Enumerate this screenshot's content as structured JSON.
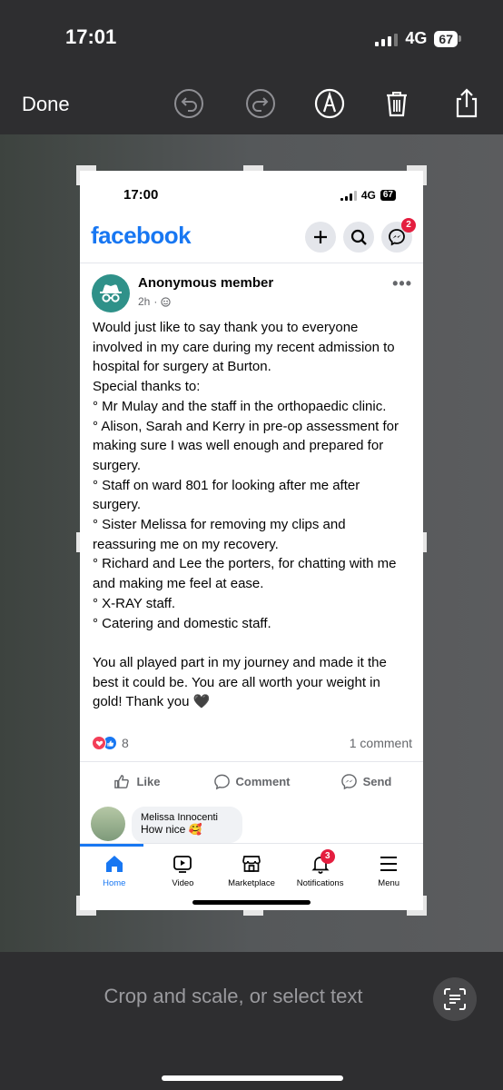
{
  "outer_status": {
    "time": "17:01",
    "network": "4G",
    "battery": "67"
  },
  "toolbar": {
    "done_label": "Done",
    "icons": [
      "undo-icon",
      "redo-icon",
      "markup-icon",
      "trash-icon",
      "share-icon"
    ]
  },
  "inner_status": {
    "time": "17:00",
    "network": "4G",
    "battery": "67"
  },
  "facebook": {
    "logo": "facebook",
    "messenger_badge": "2",
    "post": {
      "author": "Anonymous member",
      "time": "2h",
      "body": "Would just like to say thank you to everyone involved in my care during my recent admission to hospital for surgery at Burton.\nSpecial thanks to:\n °  Mr Mulay and the staff in the orthopaedic clinic.\n ° Alison, Sarah and Kerry in pre-op assessment for making  sure I was well enough and prepared for surgery.\n ° Staff on  ward 801 for looking after me after surgery.\n°  Sister Melissa for removing my clips and reassuring me on my recovery.\n °  Richard and Lee the porters, for chatting with me and making me feel at ease.\n° X-RAY staff.\n° Catering and domestic staff.\n\nYou all played part in my journey and made it the best it could be. You are all worth your weight in gold! Thank you 🖤",
      "reaction_count": "8",
      "comment_count": "1 comment",
      "actions": {
        "like": "Like",
        "comment": "Comment",
        "send": "Send"
      },
      "preview_comment": {
        "name": "Melissa Innocenti",
        "text": "How nice 🥰"
      }
    },
    "tabs": [
      {
        "label": "Home"
      },
      {
        "label": "Video"
      },
      {
        "label": "Marketplace"
      },
      {
        "label": "Notifications",
        "badge": "3"
      },
      {
        "label": "Menu"
      }
    ]
  },
  "bottom": {
    "hint": "Crop and scale, or select text"
  },
  "colors": {
    "facebook_blue": "#1877f2",
    "badge_red": "#e41e3f",
    "anon_avatar": "#2f9189",
    "dark_chrome": "#2e2e30"
  }
}
